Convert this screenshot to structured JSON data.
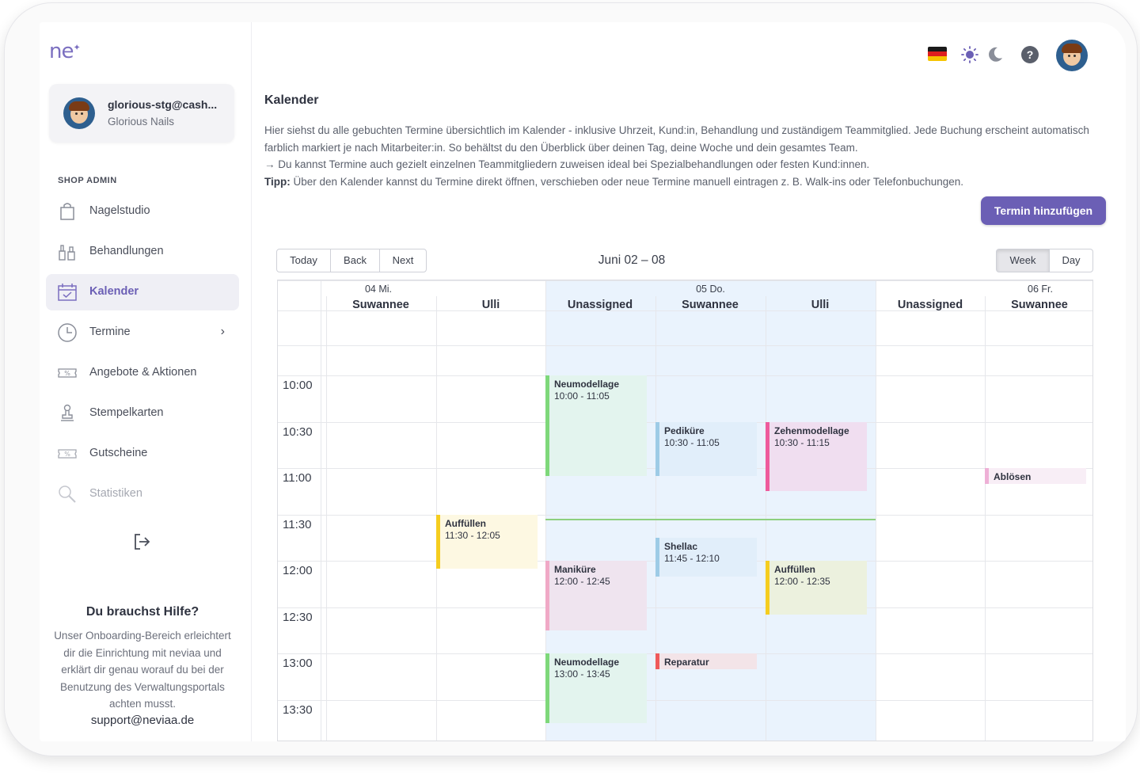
{
  "sidebar": {
    "logo": "ne",
    "user": {
      "email": "glorious-stg@cash...",
      "shop": "Glorious Nails"
    },
    "section": "SHOP ADMIN",
    "items": [
      {
        "label": "Nagelstudio",
        "icon": "shopping-bag-icon"
      },
      {
        "label": "Behandlungen",
        "icon": "nail-polish-icon"
      },
      {
        "label": "Kalender",
        "icon": "calendar-check-icon",
        "active": true
      },
      {
        "label": "Termine",
        "icon": "clock-icon",
        "chevron": "›"
      },
      {
        "label": "Angebote & Aktionen",
        "icon": "percent-ticket-icon"
      },
      {
        "label": "Stempelkarten",
        "icon": "stamp-icon"
      },
      {
        "label": "Gutscheine",
        "icon": "voucher-icon"
      },
      {
        "label": "Statistiken",
        "icon": "magnifier-icon",
        "disabled": true
      }
    ],
    "help": {
      "title": "Du brauchst Hilfe?",
      "text": "Unser Onboarding-Bereich erleichtert dir die Einrichtung mit neviaa und erklärt dir genau worauf du bei der Benutzung des Verwaltungsportals achten musst.",
      "email": "support@neviaa.de"
    }
  },
  "header": {
    "help_symbol": "?"
  },
  "main": {
    "title": "Kalender",
    "desc_line1": "Hier siehst du alle gebuchten Termine übersichtlich im Kalender - inklusive Uhrzeit, Kund:in, Behandlung und zuständigem Teammitglied. Jede Buchung erscheint automatisch farblich markiert je nach Mitarbeiter:in. So behältst du den Überblick über deinen Tag, deine Woche und dein gesamtes Team.",
    "desc_line2": "→ Du kannst Termine auch gezielt einzelnen Teammitgliedern zuweisen ideal bei Spezialbehandlungen oder festen Kund:innen.",
    "tip_label": "Tipp:",
    "tip_text": " Über den Kalender kannst du Termine direkt öffnen, verschieben oder neue Termine manuell eintragen z. B. Walk-ins oder Telefonbuchungen.",
    "add_button": "Termin hinzufügen"
  },
  "toolbar": {
    "today": "Today",
    "back": "Back",
    "next": "Next",
    "range": "Juni 02 – 08",
    "week": "Week",
    "day": "Day",
    "active_view": "Week"
  },
  "calendar": {
    "dates": [
      "04 Mi.",
      "05 Do.",
      "06 Fr."
    ],
    "resources": [
      "Suwannee",
      "Ulli",
      "Unassigned",
      "Suwannee",
      "Ulli",
      "Unassigned",
      "Suwannee"
    ],
    "times": [
      "10:00",
      "10:30",
      "11:00",
      "11:30",
      "12:00",
      "12:30",
      "13:00",
      "13:30"
    ],
    "events": [
      {
        "title": "Neumodellage",
        "time": "10:00 - 11:05",
        "column": 2,
        "start": "10:00",
        "end": "11:05",
        "color": "#7ed87a",
        "bg": "#e3f4ee"
      },
      {
        "title": "Pediküre",
        "time": "10:30 - 11:05",
        "column": 3,
        "start": "10:30",
        "end": "11:05",
        "color": "#9dcbe6",
        "bg": "#e1eefa"
      },
      {
        "title": "Zehenmodellage",
        "time": "10:30 - 11:15",
        "column": 4,
        "start": "10:30",
        "end": "11:15",
        "color": "#ee5b9c",
        "bg": "#f0def0"
      },
      {
        "title": "Ablösen",
        "time": "",
        "column": 6,
        "start": "11:00",
        "end": "11:10",
        "color": "#eeb0d6",
        "bg": "#f8eef6"
      },
      {
        "title": "Auffüllen",
        "time": "11:30 - 12:05",
        "column": 1,
        "start": "11:30",
        "end": "12:05",
        "color": "#f5cd1f",
        "bg": "#fdf8e2"
      },
      {
        "title": "Shellac",
        "time": "11:45 - 12:10",
        "column": 3,
        "start": "11:45",
        "end": "12:10",
        "color": "#9dcbe6",
        "bg": "#e1eefa"
      },
      {
        "title": "Maniküre",
        "time": "12:00 - 12:45",
        "column": 2,
        "start": "12:00",
        "end": "12:45",
        "color": "#f0a9c6",
        "bg": "#efe4ef"
      },
      {
        "title": "Auffüllen",
        "time": "12:00 - 12:35",
        "column": 4,
        "start": "12:00",
        "end": "12:35",
        "color": "#f5cd1f",
        "bg": "#ecf1de"
      },
      {
        "title": "Neumodellage",
        "time": "13:00 - 13:45",
        "column": 2,
        "start": "13:00",
        "end": "13:45",
        "color": "#7ed87a",
        "bg": "#e3f4ee"
      },
      {
        "title": "Reparatur",
        "time": "",
        "column": 3,
        "start": "13:00",
        "end": "13:10",
        "color": "#ef5a5a",
        "bg": "#f3e4e8"
      }
    ],
    "today_highlight": "#eaf3fd",
    "now_time": "11:35"
  }
}
